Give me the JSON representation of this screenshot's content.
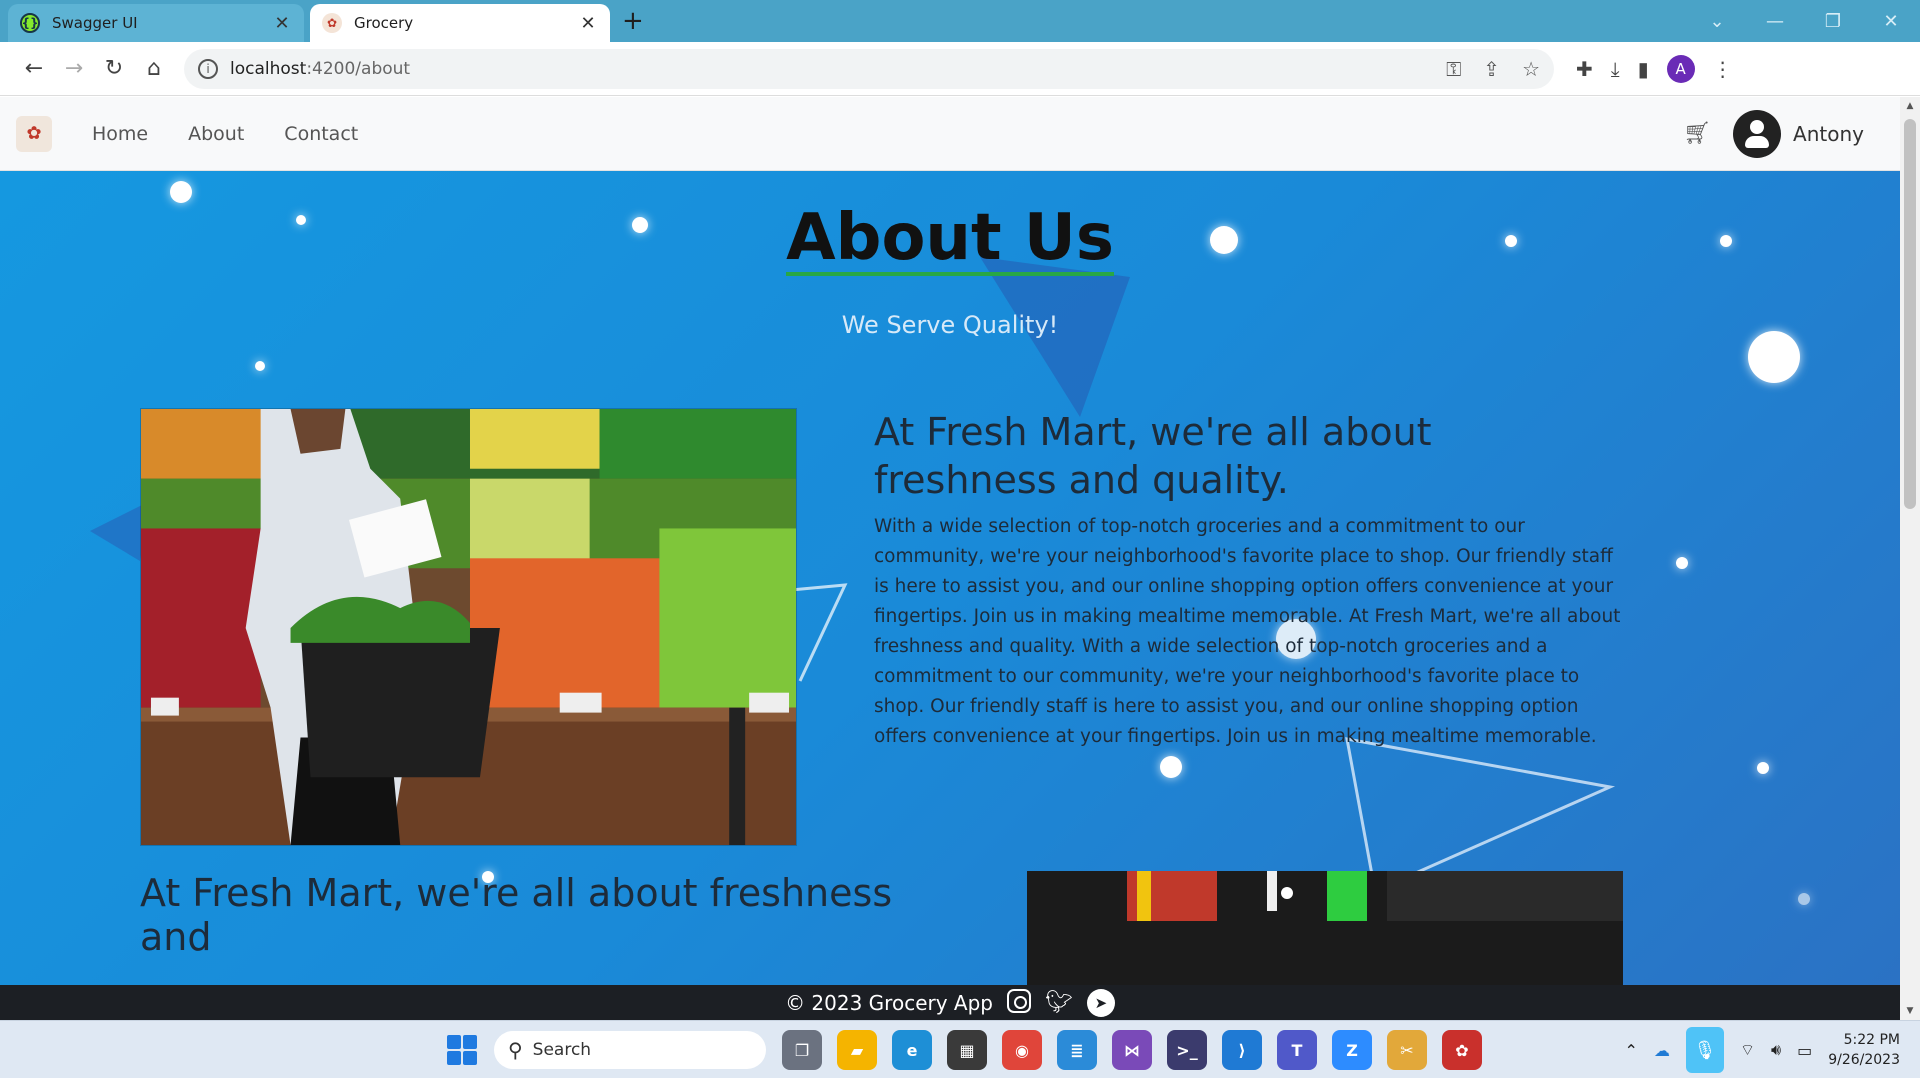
{
  "browser": {
    "tabs": [
      {
        "title": "Swagger UI",
        "active": false
      },
      {
        "title": "Grocery",
        "active": true
      }
    ],
    "url_host": "localhost",
    "url_path": ":4200/about",
    "profile_initial": "A"
  },
  "site": {
    "nav": {
      "links": [
        "Home",
        "About",
        "Contact"
      ],
      "user_name": "Antony"
    },
    "hero": {
      "title": "About Us",
      "subtitle": "We Serve Quality!"
    },
    "section1": {
      "heading": "At Fresh Mart, we're all about freshness and quality.",
      "body": "With a wide selection of top-notch groceries and a commitment to our community, we're your neighborhood's favorite place to shop. Our friendly staff is here to assist you, and our online shopping option offers convenience at your fingertips. Join us in making mealtime memorable. At Fresh Mart, we're all about freshness and quality. With a wide selection of top-notch groceries and a commitment to our community, we're your neighborhood's favorite place to shop. Our friendly staff is here to assist you, and our online shopping option offers convenience at your fingertips. Join us in making mealtime memorable."
    },
    "section2": {
      "heading": "At Fresh Mart, we're all about freshness and"
    },
    "footer": {
      "copyright": "© 2023 Grocery App"
    }
  },
  "taskbar": {
    "search_placeholder": "Search",
    "time": "5:22 PM",
    "date": "9/26/2023"
  },
  "colors": {
    "hero_start": "#1598e0",
    "hero_end": "#2b72c4",
    "title_underline": "#28a745",
    "footer_bg": "#1c1f24"
  }
}
